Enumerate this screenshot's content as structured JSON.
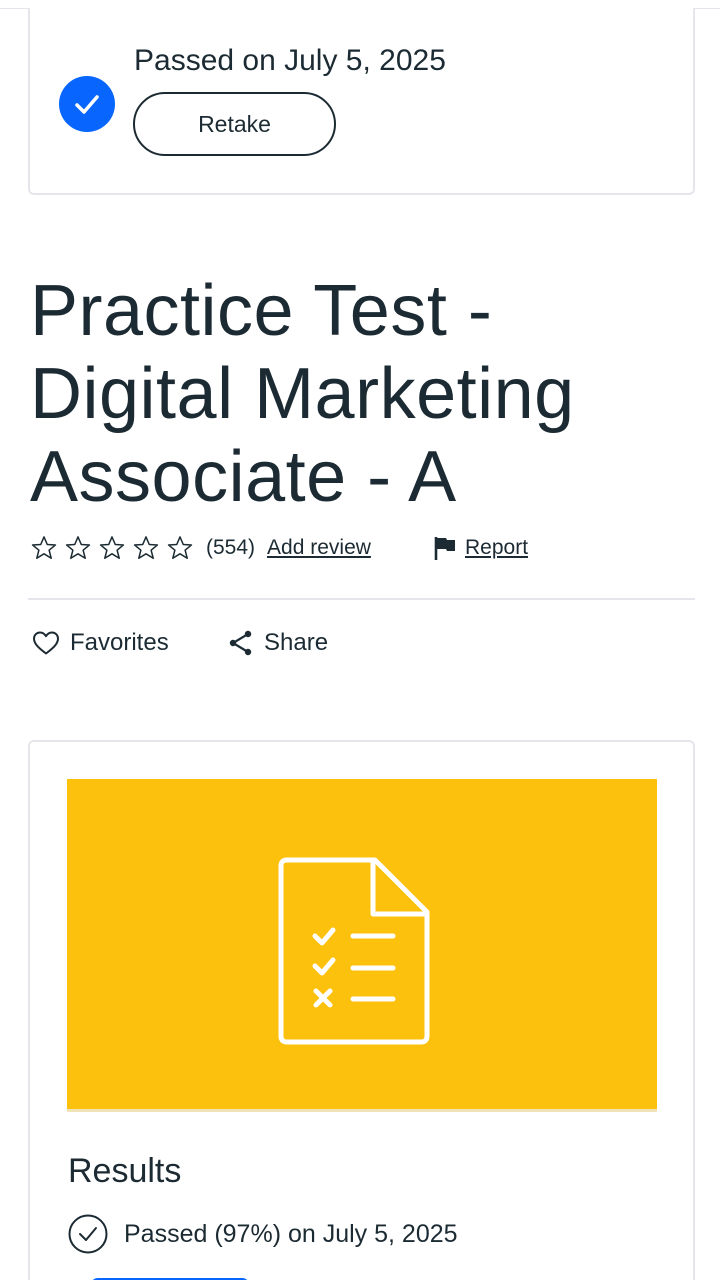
{
  "status": {
    "passed_label": "Passed on July 5, 2025",
    "retake_label": "Retake"
  },
  "course": {
    "title": "Practice Test - Digital Marketing Associate - A",
    "rating_stars_filled": 0,
    "rating_stars_total": 5,
    "review_count": "(554)",
    "add_review_label": "Add review",
    "report_label": "Report"
  },
  "actions": {
    "favorites_label": "Favorites",
    "share_label": "Share"
  },
  "results": {
    "heading": "Results",
    "summary": "Passed (97%) on July 5, 2025"
  },
  "colors": {
    "accent_blue": "#0866ff",
    "banner_yellow": "#fcc10c",
    "text_dark": "#1c2b33"
  },
  "icons": [
    "check-circle-icon",
    "star-outline-icon",
    "flag-icon",
    "heart-icon",
    "share-icon",
    "checklist-document-icon",
    "check-outline-icon"
  ]
}
